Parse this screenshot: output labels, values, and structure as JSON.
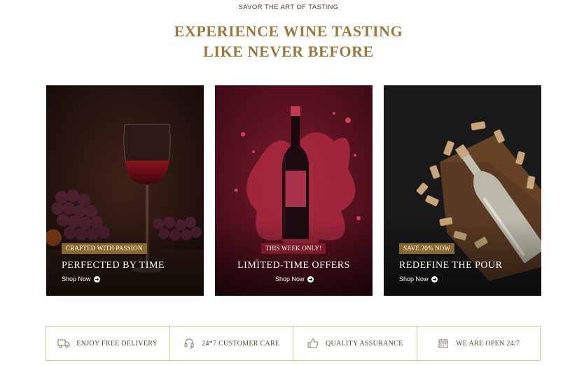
{
  "header": {
    "eyebrow": "SAVOR THE ART OF TASTING",
    "title_line1": "EXPERIENCE WINE TASTING",
    "title_line2": "LIKE NEVER BEFORE"
  },
  "cards": [
    {
      "badge": "CRAFTED WITH PASSION",
      "title": "PERFECTED BY TIME",
      "link": "Shop Now",
      "badge_color": "#8a6a2c"
    },
    {
      "badge": "THIS WEEK ONLY!",
      "title": "LIMITED-TIME OFFERS",
      "link": "Shop Now",
      "badge_color": "#7a1a28"
    },
    {
      "badge": "SAVE 20% NOW",
      "title": "REDEFINE THE POUR",
      "link": "Shop Now",
      "badge_color": "#8a6a2c"
    }
  ],
  "features": [
    {
      "icon": "truck-icon",
      "label": "ENJOY FREE DELIVERY"
    },
    {
      "icon": "headset-icon",
      "label": "24*7 CUSTOMER CARE"
    },
    {
      "icon": "thumbs-up-icon",
      "label": "QUALITY ASSURANCE"
    },
    {
      "icon": "calendar-icon",
      "label": "WE ARE OPEN 24/7"
    }
  ],
  "colors": {
    "accent_gold": "#9a7a3e",
    "border": "#d9c7a0",
    "wine_red": "#7a1a28"
  }
}
